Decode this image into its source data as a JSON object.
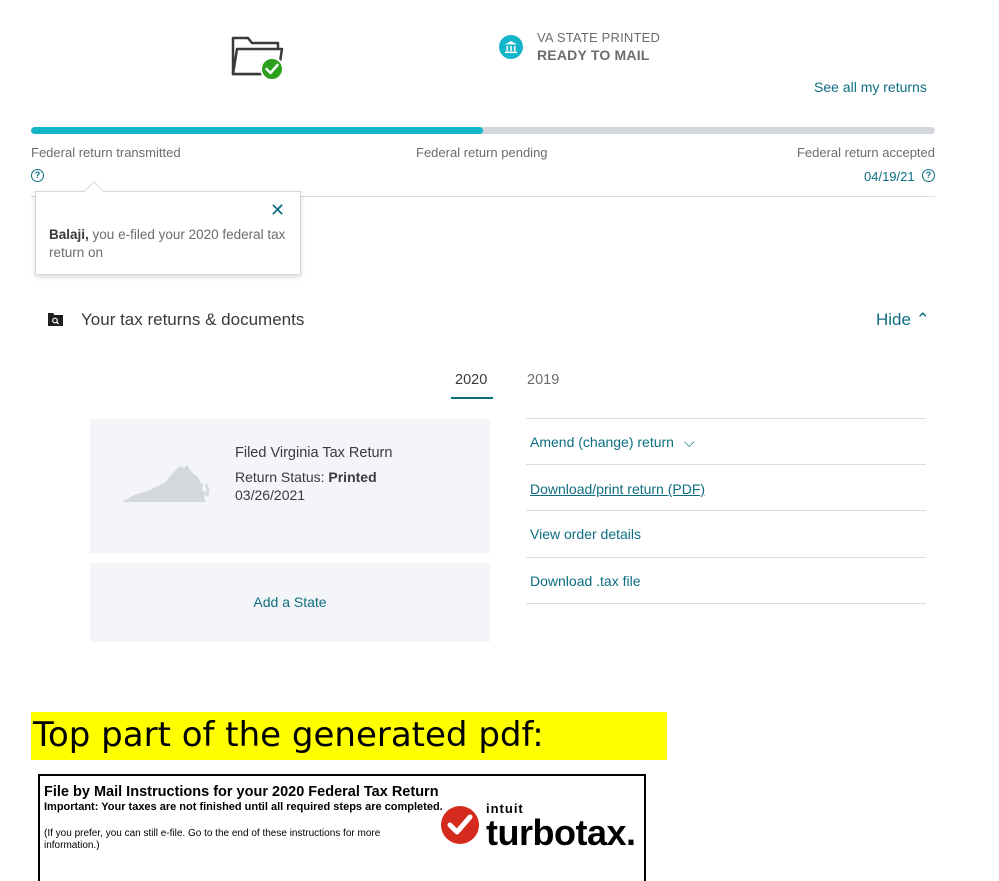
{
  "status": {
    "state_line1": "VA STATE PRINTED",
    "state_line2": "READY TO MAIL",
    "see_all_link": "See all my returns"
  },
  "progress": {
    "fraction": 0.5,
    "steps": [
      {
        "label": "Federal return transmitted"
      },
      {
        "label": "Federal return pending"
      },
      {
        "label": "Federal return accepted",
        "date": "04/19/21"
      }
    ],
    "help_glyph": "?"
  },
  "tooltip": {
    "close_glyph": "✕",
    "name": "Balaji,",
    "message": "you e-filed your 2020 federal tax return on"
  },
  "returns_section": {
    "title": "Your tax returns & documents",
    "toggle_label": "Hide ⌃",
    "tabs": [
      {
        "label": "2020",
        "selected": true
      },
      {
        "label": "2019",
        "selected": false
      }
    ],
    "card": {
      "title": "Filed Virginia Tax Return",
      "status_label": "Return Status:",
      "status_value": "Printed",
      "date": "03/26/2021"
    },
    "add_state_label": "Add a State",
    "actions": [
      {
        "label": "Amend (change) return",
        "chevron": "⌵"
      },
      {
        "label": "Download/print return (PDF)"
      },
      {
        "label": "View order details"
      },
      {
        "label": "Download .tax file"
      }
    ]
  },
  "annotation": {
    "caption": "Top part of the generated pdf:",
    "highlight_color": "#ffff00"
  },
  "pdf": {
    "title": "File by Mail Instructions for your 2020 Federal Tax Return",
    "important": "Important: Your taxes are not finished until all required steps are completed.",
    "note": "(If you prefer, you can still e-file.  Go to the end of these instructions for more information.)",
    "logo_intuit": "intuit",
    "logo_word": "turbotax."
  },
  "colors": {
    "accent_teal": "#13b5c8",
    "link_teal": "#0d6e82",
    "success_green": "#2ca01c",
    "turbotax_red": "#d52b1e"
  },
  "icons": {
    "status": "folder-check-icon",
    "state": "bank-icon",
    "docs": "document-search-icon",
    "map": "virginia-map-icon",
    "brand": "turbotax-check-icon"
  }
}
